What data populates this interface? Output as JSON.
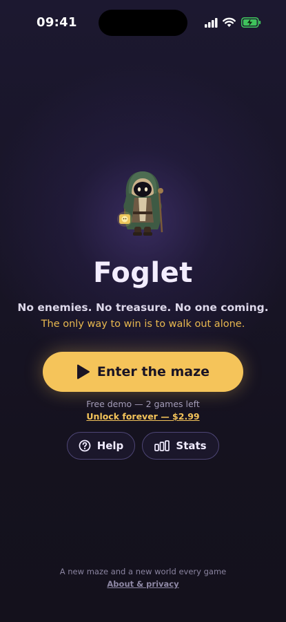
{
  "status_bar": {
    "time": "09:41"
  },
  "app": {
    "title": "Foglet",
    "tagline_1": "No enemies. No treasure. No one coming.",
    "tagline_2": "The only way to win is to walk out alone."
  },
  "cta": {
    "label": "Enter the maze",
    "icon": "play-icon"
  },
  "demo": {
    "note": "Free demo — 2 games left",
    "unlock_label": "Unlock forever — $2.99"
  },
  "buttons": {
    "help": {
      "label": "Help",
      "icon": "question-icon"
    },
    "stats": {
      "label": "Stats",
      "icon": "bar-chart-icon"
    }
  },
  "footer": {
    "note": "A new maze and a new world every game",
    "link": "About & privacy"
  },
  "colors": {
    "accent": "#f5c45a",
    "background": "#181425",
    "tagline_accent": "#e8b84f"
  }
}
